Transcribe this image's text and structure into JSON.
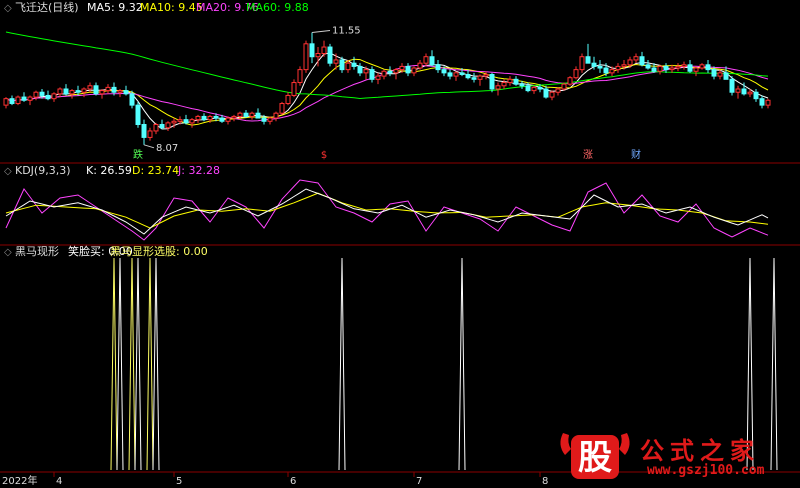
{
  "colors": {
    "ma5": "#ffffff",
    "ma10": "#ffff00",
    "ma20": "#ff44ff",
    "ma60": "#00ff00",
    "up": "#ff3232",
    "down": "#54ffff",
    "divider": "#8b0000",
    "kdj_k": "#ffffff",
    "kdj_d": "#ffff00",
    "kdj_j": "#ff44ff",
    "signal1": "#ffffff",
    "signal2": "#ffff66"
  },
  "chart_data": [
    {
      "type": "candlestick",
      "legend": {
        "title": "飞迁达(日线)",
        "ma5": "MA5: 9.32",
        "ma10": "MA10: 9.45",
        "ma20": "MA20: 9.76",
        "ma60": "MA60: 9.88"
      },
      "annotations": {
        "high": "11.55",
        "low": "8.07"
      },
      "markers": [
        {
          "label": "跌",
          "color": "#54ff54",
          "index": 22
        },
        {
          "label": "$",
          "color": "#ff3232",
          "index": 53
        },
        {
          "label": "涨",
          "color": "#ff6666",
          "index": 97
        },
        {
          "label": "财",
          "color": "#6fa8ff",
          "index": 105
        }
      ],
      "ylim": [
        7.6,
        12.0
      ],
      "candles": [
        [
          9.3,
          9.55,
          9.2,
          9.5
        ],
        [
          9.5,
          9.6,
          9.3,
          9.35
        ],
        [
          9.35,
          9.6,
          9.3,
          9.55
        ],
        [
          9.55,
          9.7,
          9.4,
          9.45
        ],
        [
          9.45,
          9.6,
          9.3,
          9.55
        ],
        [
          9.55,
          9.75,
          9.45,
          9.7
        ],
        [
          9.7,
          9.8,
          9.5,
          9.6
        ],
        [
          9.6,
          9.75,
          9.45,
          9.5
        ],
        [
          9.5,
          9.7,
          9.4,
          9.65
        ],
        [
          9.65,
          9.85,
          9.55,
          9.8
        ],
        [
          9.8,
          9.95,
          9.6,
          9.65
        ],
        [
          9.65,
          9.8,
          9.5,
          9.75
        ],
        [
          9.75,
          9.9,
          9.6,
          9.7
        ],
        [
          9.7,
          9.85,
          9.55,
          9.8
        ],
        [
          9.8,
          10.0,
          9.7,
          9.9
        ],
        [
          9.9,
          10.0,
          9.6,
          9.65
        ],
        [
          9.65,
          9.8,
          9.5,
          9.75
        ],
        [
          9.75,
          9.95,
          9.65,
          9.85
        ],
        [
          9.85,
          10.0,
          9.6,
          9.7
        ],
        [
          9.7,
          9.8,
          9.55,
          9.75
        ],
        [
          9.75,
          9.9,
          9.6,
          9.65
        ],
        [
          9.65,
          9.75,
          9.2,
          9.3
        ],
        [
          9.3,
          9.4,
          8.6,
          8.7
        ],
        [
          8.7,
          8.85,
          8.07,
          8.3
        ],
        [
          8.3,
          8.6,
          8.2,
          8.5
        ],
        [
          8.5,
          8.75,
          8.4,
          8.7
        ],
        [
          8.7,
          8.85,
          8.55,
          8.6
        ],
        [
          8.6,
          8.8,
          8.5,
          8.75
        ],
        [
          8.75,
          8.9,
          8.6,
          8.8
        ],
        [
          8.8,
          8.95,
          8.7,
          8.85
        ],
        [
          8.85,
          9.0,
          8.7,
          8.75
        ],
        [
          8.75,
          8.9,
          8.6,
          8.85
        ],
        [
          8.85,
          9.0,
          8.75,
          8.95
        ],
        [
          8.95,
          9.05,
          8.8,
          8.85
        ],
        [
          8.85,
          9.0,
          8.75,
          8.95
        ],
        [
          8.95,
          9.05,
          8.8,
          8.9
        ],
        [
          8.9,
          9.0,
          8.75,
          8.8
        ],
        [
          8.8,
          8.95,
          8.7,
          8.9
        ],
        [
          8.9,
          9.0,
          8.8,
          8.95
        ],
        [
          8.95,
          9.1,
          8.85,
          9.05
        ],
        [
          9.05,
          9.15,
          8.9,
          8.95
        ],
        [
          8.95,
          9.1,
          8.85,
          9.05
        ],
        [
          9.05,
          9.2,
          8.95,
          8.9
        ],
        [
          8.9,
          9.0,
          8.7,
          8.8
        ],
        [
          8.8,
          8.95,
          8.7,
          8.9
        ],
        [
          8.9,
          9.1,
          8.8,
          9.05
        ],
        [
          9.05,
          9.4,
          9.0,
          9.35
        ],
        [
          9.35,
          9.7,
          9.3,
          9.6
        ],
        [
          9.6,
          10.1,
          9.55,
          10.0
        ],
        [
          10.0,
          10.5,
          9.9,
          10.4
        ],
        [
          10.4,
          11.3,
          10.3,
          11.2
        ],
        [
          11.2,
          11.55,
          10.6,
          10.8
        ],
        [
          10.8,
          11.1,
          10.5,
          10.9
        ],
        [
          10.9,
          11.3,
          10.8,
          11.1
        ],
        [
          11.1,
          11.2,
          10.5,
          10.6
        ],
        [
          10.6,
          10.9,
          10.4,
          10.7
        ],
        [
          10.7,
          10.8,
          10.3,
          10.4
        ],
        [
          10.4,
          10.7,
          10.3,
          10.6
        ],
        [
          10.6,
          10.8,
          10.4,
          10.5
        ],
        [
          10.5,
          10.6,
          10.2,
          10.3
        ],
        [
          10.3,
          10.5,
          10.1,
          10.4
        ],
        [
          10.4,
          10.5,
          10.0,
          10.1
        ],
        [
          10.1,
          10.3,
          9.95,
          10.2
        ],
        [
          10.2,
          10.4,
          10.1,
          10.35
        ],
        [
          10.35,
          10.5,
          10.2,
          10.3
        ],
        [
          10.3,
          10.45,
          10.1,
          10.4
        ],
        [
          10.4,
          10.6,
          10.3,
          10.5
        ],
        [
          10.5,
          10.6,
          10.2,
          10.3
        ],
        [
          10.3,
          10.5,
          10.2,
          10.45
        ],
        [
          10.45,
          10.7,
          10.4,
          10.6
        ],
        [
          10.6,
          10.9,
          10.5,
          10.8
        ],
        [
          10.8,
          11.0,
          10.5,
          10.55
        ],
        [
          10.55,
          10.7,
          10.3,
          10.4
        ],
        [
          10.4,
          10.5,
          10.2,
          10.3
        ],
        [
          10.3,
          10.4,
          10.1,
          10.2
        ],
        [
          10.2,
          10.35,
          10.05,
          10.3
        ],
        [
          10.3,
          10.45,
          10.2,
          10.25
        ],
        [
          10.25,
          10.4,
          10.1,
          10.15
        ],
        [
          10.15,
          10.3,
          10.0,
          10.1
        ],
        [
          10.1,
          10.25,
          9.9,
          10.2
        ],
        [
          10.2,
          10.35,
          10.1,
          10.25
        ],
        [
          10.25,
          10.3,
          9.7,
          9.8
        ],
        [
          9.8,
          10.0,
          9.6,
          9.9
        ],
        [
          9.9,
          10.1,
          9.8,
          10.0
        ],
        [
          10.0,
          10.2,
          9.9,
          10.1
        ],
        [
          10.1,
          10.2,
          9.9,
          9.95
        ],
        [
          9.95,
          10.05,
          9.8,
          9.9
        ],
        [
          9.9,
          10.0,
          9.7,
          9.75
        ],
        [
          9.75,
          9.9,
          9.65,
          9.85
        ],
        [
          9.85,
          9.95,
          9.7,
          9.8
        ],
        [
          9.8,
          9.9,
          9.5,
          9.55
        ],
        [
          9.55,
          9.75,
          9.45,
          9.7
        ],
        [
          9.7,
          9.85,
          9.6,
          9.8
        ],
        [
          9.8,
          10.0,
          9.75,
          9.95
        ],
        [
          9.95,
          10.2,
          9.9,
          10.15
        ],
        [
          10.15,
          10.5,
          10.1,
          10.4
        ],
        [
          10.4,
          10.9,
          10.3,
          10.8
        ],
        [
          10.8,
          11.2,
          10.7,
          10.6
        ],
        [
          10.6,
          10.8,
          10.4,
          10.5
        ],
        [
          10.5,
          10.7,
          10.3,
          10.45
        ],
        [
          10.45,
          10.6,
          10.2,
          10.3
        ],
        [
          10.3,
          10.5,
          10.2,
          10.4
        ],
        [
          10.4,
          10.6,
          10.3,
          10.5
        ],
        [
          10.5,
          10.7,
          10.4,
          10.55
        ],
        [
          10.55,
          10.8,
          10.45,
          10.7
        ],
        [
          10.7,
          10.9,
          10.6,
          10.8
        ],
        [
          10.8,
          10.95,
          10.5,
          10.55
        ],
        [
          10.55,
          10.7,
          10.4,
          10.45
        ],
        [
          10.45,
          10.6,
          10.3,
          10.35
        ],
        [
          10.35,
          10.55,
          10.25,
          10.5
        ],
        [
          10.5,
          10.6,
          10.3,
          10.4
        ],
        [
          10.4,
          10.55,
          10.3,
          10.45
        ],
        [
          10.45,
          10.6,
          10.35,
          10.5
        ],
        [
          10.5,
          10.65,
          10.4,
          10.55
        ],
        [
          10.55,
          10.7,
          10.3,
          10.35
        ],
        [
          10.35,
          10.5,
          10.2,
          10.45
        ],
        [
          10.45,
          10.6,
          10.4,
          10.55
        ],
        [
          10.55,
          10.7,
          10.3,
          10.4
        ],
        [
          10.4,
          10.5,
          10.1,
          10.2
        ],
        [
          10.2,
          10.4,
          10.1,
          10.3
        ],
        [
          10.3,
          10.5,
          10.2,
          10.1
        ],
        [
          10.1,
          10.2,
          9.6,
          9.7
        ],
        [
          9.7,
          9.9,
          9.5,
          9.8
        ],
        [
          9.8,
          10.0,
          9.6,
          9.65
        ],
        [
          9.65,
          9.8,
          9.55,
          9.7
        ],
        [
          9.7,
          9.8,
          9.4,
          9.5
        ],
        [
          9.5,
          9.6,
          9.2,
          9.3
        ],
        [
          9.3,
          9.5,
          9.2,
          9.45
        ]
      ]
    },
    {
      "type": "line",
      "legend": {
        "title": "KDJ(9,3,3)",
        "k": "K: 26.59",
        "d": "D: 23.74",
        "j": "J: 32.28"
      },
      "ylim": [
        0,
        100
      ],
      "k_keys": [
        [
          0,
          40
        ],
        [
          4,
          65
        ],
        [
          8,
          55
        ],
        [
          12,
          62
        ],
        [
          16,
          50
        ],
        [
          20,
          30
        ],
        [
          23,
          10
        ],
        [
          26,
          38
        ],
        [
          30,
          55
        ],
        [
          34,
          45
        ],
        [
          38,
          58
        ],
        [
          42,
          40
        ],
        [
          46,
          60
        ],
        [
          50,
          85
        ],
        [
          54,
          70
        ],
        [
          58,
          52
        ],
        [
          62,
          45
        ],
        [
          66,
          58
        ],
        [
          70,
          38
        ],
        [
          74,
          50
        ],
        [
          78,
          42
        ],
        [
          82,
          30
        ],
        [
          86,
          45
        ],
        [
          90,
          40
        ],
        [
          94,
          35
        ],
        [
          98,
          75
        ],
        [
          102,
          55
        ],
        [
          106,
          60
        ],
        [
          110,
          45
        ],
        [
          114,
          55
        ],
        [
          118,
          38
        ],
        [
          122,
          25
        ],
        [
          126,
          42
        ],
        [
          129,
          26.59
        ]
      ],
      "d_keys": [
        [
          0,
          45
        ],
        [
          5,
          58
        ],
        [
          10,
          55
        ],
        [
          15,
          52
        ],
        [
          20,
          38
        ],
        [
          24,
          20
        ],
        [
          28,
          40
        ],
        [
          32,
          50
        ],
        [
          36,
          48
        ],
        [
          40,
          52
        ],
        [
          44,
          48
        ],
        [
          48,
          62
        ],
        [
          52,
          78
        ],
        [
          56,
          62
        ],
        [
          60,
          50
        ],
        [
          64,
          52
        ],
        [
          68,
          48
        ],
        [
          72,
          45
        ],
        [
          76,
          46
        ],
        [
          80,
          38
        ],
        [
          84,
          40
        ],
        [
          88,
          42
        ],
        [
          92,
          38
        ],
        [
          96,
          55
        ],
        [
          100,
          62
        ],
        [
          104,
          58
        ],
        [
          108,
          52
        ],
        [
          112,
          50
        ],
        [
          116,
          45
        ],
        [
          120,
          32
        ],
        [
          124,
          30
        ],
        [
          129,
          23.74
        ]
      ],
      "j_keys": [
        [
          0,
          20
        ],
        [
          3,
          85
        ],
        [
          6,
          45
        ],
        [
          9,
          70
        ],
        [
          12,
          75
        ],
        [
          15,
          55
        ],
        [
          18,
          35
        ],
        [
          21,
          15
        ],
        [
          23,
          0
        ],
        [
          25,
          20
        ],
        [
          28,
          70
        ],
        [
          31,
          65
        ],
        [
          34,
          30
        ],
        [
          37,
          70
        ],
        [
          40,
          55
        ],
        [
          43,
          20
        ],
        [
          46,
          68
        ],
        [
          49,
          100
        ],
        [
          52,
          95
        ],
        [
          55,
          55
        ],
        [
          58,
          45
        ],
        [
          61,
          30
        ],
        [
          64,
          60
        ],
        [
          67,
          65
        ],
        [
          70,
          15
        ],
        [
          73,
          55
        ],
        [
          76,
          45
        ],
        [
          79,
          35
        ],
        [
          82,
          15
        ],
        [
          85,
          55
        ],
        [
          88,
          40
        ],
        [
          91,
          25
        ],
        [
          94,
          15
        ],
        [
          97,
          80
        ],
        [
          100,
          95
        ],
        [
          103,
          45
        ],
        [
          106,
          75
        ],
        [
          109,
          40
        ],
        [
          112,
          30
        ],
        [
          115,
          60
        ],
        [
          118,
          20
        ],
        [
          121,
          5
        ],
        [
          124,
          20
        ],
        [
          127,
          8
        ],
        [
          129,
          32.28
        ]
      ]
    },
    {
      "type": "line",
      "legend": {
        "title": "黑马现形",
        "s1": "笑脸买: 0.00",
        "s2": "黑马显形选股: 0.00"
      },
      "spikes": [
        {
          "index": 18,
          "series": "s2"
        },
        {
          "index": 19,
          "series": "s1"
        },
        {
          "index": 21,
          "series": "s2"
        },
        {
          "index": 22,
          "series": "s1"
        },
        {
          "index": 24,
          "series": "s2"
        },
        {
          "index": 25,
          "series": "s1"
        },
        {
          "index": 56,
          "series": "s1"
        },
        {
          "index": 76,
          "series": "s1"
        },
        {
          "index": 124,
          "series": "s1"
        },
        {
          "index": 128,
          "series": "s1"
        }
      ]
    }
  ],
  "x_axis": {
    "year": "2022年",
    "months": [
      {
        "label": "4",
        "index": 8
      },
      {
        "label": "5",
        "index": 28
      },
      {
        "label": "6",
        "index": 47
      },
      {
        "label": "7",
        "index": 68
      },
      {
        "label": "8",
        "index": 89
      }
    ]
  },
  "watermark": {
    "chinese": "公式之家",
    "url": "www.gszj100.com",
    "logo_char": "股"
  }
}
